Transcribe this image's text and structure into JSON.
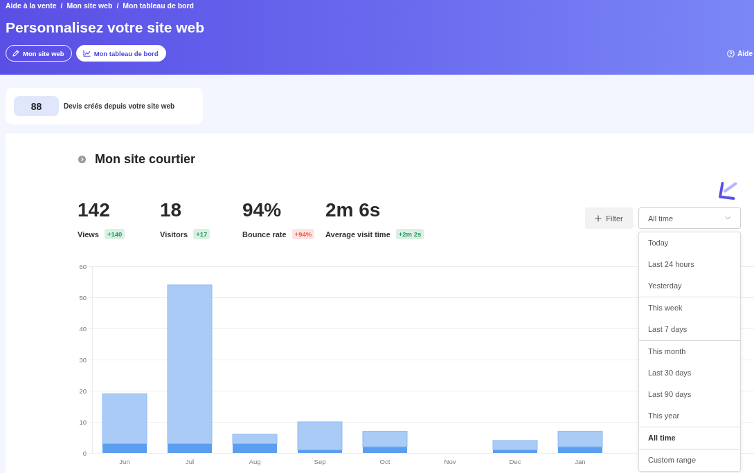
{
  "header": {
    "breadcrumb": [
      {
        "label": "Aide à la vente",
        "separator": "/"
      },
      {
        "label": "Mon site web",
        "separator": "/"
      },
      {
        "label": "Mon tableau de bord"
      }
    ],
    "title": "Personnalisez votre site web",
    "buttons": [
      {
        "label": "Mon site web",
        "selected": false
      },
      {
        "label": "Mon tableau de bord",
        "selected": true
      }
    ],
    "help": {
      "label": "Aide"
    }
  },
  "summary_card": {
    "count": "88",
    "label": "Devis créés depuis votre site web"
  },
  "panel": {
    "title": "Mon site courtier",
    "stats": [
      {
        "value": "142",
        "label": "Views",
        "change": "+140",
        "color": "#1f9d55"
      },
      {
        "value": "18",
        "label": "Visitors",
        "change": "+17",
        "color": "#1f9d55"
      },
      {
        "value": "94%",
        "label": "Bounce rate",
        "change": "+94%",
        "color": "#ef5a4c"
      },
      {
        "value": "2m 6s",
        "label": "Average visit time",
        "change": "+2m 2s",
        "color": "#1f9d55"
      }
    ],
    "filter": {
      "label": "Filter"
    },
    "range_select": {
      "value": "All time",
      "expanded": true,
      "groups": [
        {
          "options": [
            {
              "label": "Today",
              "selected": false
            },
            {
              "label": "Last 24 hours",
              "selected": false
            },
            {
              "label": "Yesterday",
              "selected": false
            }
          ]
        },
        {
          "options": [
            {
              "label": "This week",
              "selected": false
            },
            {
              "label": "Last 7 days",
              "selected": false
            }
          ]
        },
        {
          "options": [
            {
              "label": "This month",
              "selected": false
            },
            {
              "label": "Last 30 days",
              "selected": false
            },
            {
              "label": "Last 90 days",
              "selected": false
            },
            {
              "label": "This year",
              "selected": false
            }
          ]
        },
        {
          "options": [
            {
              "label": "All time",
              "selected": true
            }
          ]
        },
        {
          "options": [
            {
              "label": "Custom range",
              "selected": false
            }
          ]
        }
      ]
    },
    "chart": {
      "chart_data": {
        "type": "bar",
        "categories": [
          "Jun",
          "Jul",
          "Aug",
          "Sep",
          "Oct",
          "Nov",
          "Dec",
          "Jan"
        ],
        "series": [
          {
            "color": "#5b9ef0",
            "values": [
              3,
              3,
              3,
              1,
              2,
              0,
              1,
              2
            ]
          },
          {
            "color": "#a9cbf6",
            "values": [
              16,
              51,
              3,
              9,
              5,
              0,
              3,
              5
            ]
          }
        ],
        "ylim": [
          0,
          60
        ],
        "yticks": [
          0,
          10,
          20,
          30,
          40,
          50,
          60
        ],
        "stacked": true,
        "grid": true
      }
    }
  }
}
